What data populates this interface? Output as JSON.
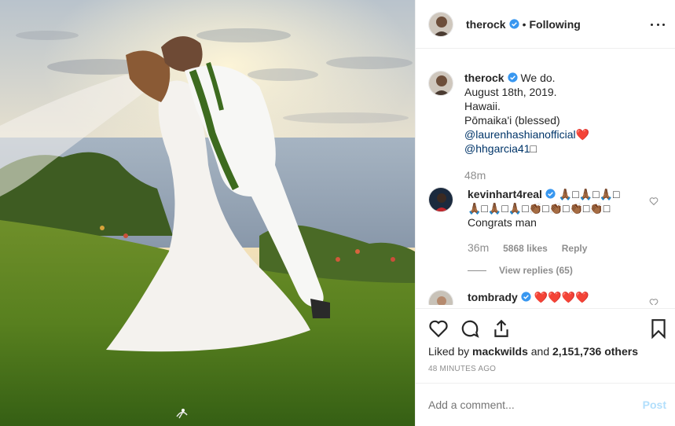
{
  "post": {
    "username": "therock",
    "separator": "•",
    "following_label": "Following",
    "more_icon": "more-options-icon"
  },
  "caption": {
    "username": "therock",
    "lines": [
      "We do.",
      "August 18th, 2019.",
      "Hawaii.",
      "Pōmaika'i (blessed)"
    ],
    "mention1": "@laurenhashianofficial",
    "heart": "❤️",
    "mention2": "@hhgarcia41",
    "mention2_suffix": "□",
    "time": "48m"
  },
  "comment1": {
    "username": "kevinhart4real",
    "emoji_line1": "🙏🏾□🙏🏾□🙏🏾□",
    "emoji_line2": "🙏🏾□🙏🏾□🙏🏾□👏🏾□👏🏾□👏🏾□👏🏾□",
    "text": "Congrats man",
    "time": "36m",
    "likes": "5868 likes",
    "reply": "Reply",
    "view_replies": "View replies (65)"
  },
  "comment2": {
    "username": "tombrady",
    "text": "❤️❤️❤️❤️"
  },
  "liked_by": {
    "prefix": "Liked by",
    "user": "mackwilds",
    "middle": "and",
    "count": "2,151,736 others"
  },
  "timestamp": "48 MINUTES AGO",
  "add_comment": {
    "placeholder": "Add a comment...",
    "post_label": "Post"
  },
  "colors": {
    "verified": "#3897f0",
    "mention": "#003569",
    "muted": "#8e8e8e",
    "post_disabled": "#b2dffc"
  }
}
